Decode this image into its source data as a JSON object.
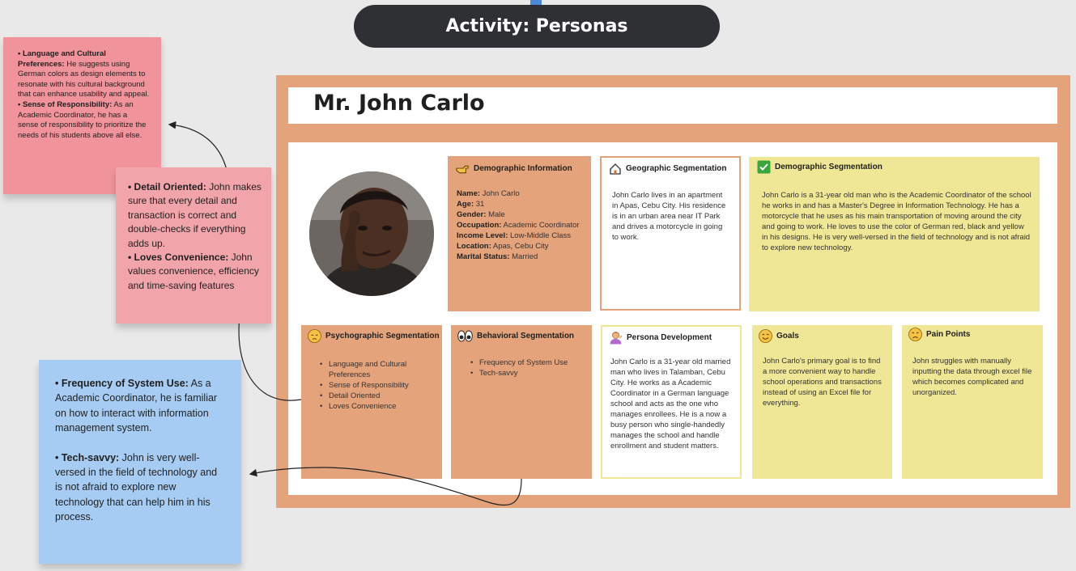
{
  "header": {
    "title": "Activity: Personas"
  },
  "persona": {
    "name": "Mr. John Carlo"
  },
  "cards": {
    "demographic_info": {
      "title": "Demographic Information",
      "rows": [
        {
          "label": "Name:",
          "value": " John Carlo"
        },
        {
          "label": "Age:",
          "value": " 31"
        },
        {
          "label": "Gender:",
          "value": " Male"
        },
        {
          "label": "Occupation:",
          "value": " Academic Coordinator"
        },
        {
          "label": "Income Level:",
          "value": " Low-Middle Class"
        },
        {
          "label": "Location:",
          "value": " Apas, Cebu City"
        },
        {
          "label": "Marital Status:",
          "value": " Married"
        }
      ]
    },
    "geographic": {
      "title": "Geographic Segmentation",
      "text": "John Carlo lives in an apartment in Apas, Cebu City. His residence is in an urban area near IT Park and drives a motorcycle in going to work."
    },
    "demographic_seg": {
      "title": "Demographic Segmentation",
      "text": "John Carlo is a 31-year old man who is the Academic Coordinator of the school he works in and has a Master's Degree in Information Technology. He has a motorcycle that he uses as his main transportation of moving around the city and going to work. He loves to use the color of German red, black and yellow in his designs. He is very well-versed in the field of technology and is not afraid to explore new technology."
    },
    "psychographic": {
      "title": "Psychographic Segmentation",
      "items": [
        "Language and Cultural Preferences",
        "Sense of Responsibility",
        "Detail Oriented",
        "Loves Convenience"
      ]
    },
    "behavioral": {
      "title": "Behavioral Segmentation",
      "items": [
        "Frequency of System Use",
        "Tech-savvy"
      ]
    },
    "persona_dev": {
      "title": "Persona Development",
      "text": "John Carlo is a 31-year old married man who lives in Talamban, Cebu City. He works as a Academic Coordinator in a German language school and acts as the one who manages enrollees. He is a now a busy person who single-handedly manages the school and handle enrollment and student matters."
    },
    "goals": {
      "title": "Goals",
      "text": "John Carlo's primary goal is to find a more convenient way to handle school operations and transactions instead of using an Excel file for everything."
    },
    "pain_points": {
      "title": "Pain Points",
      "text": "John struggles with manually inputting the data through excel file which becomes complicated and unorganized."
    }
  },
  "stickies": {
    "pink_top": {
      "b1": "• Language and Cultural Preferences:",
      "t1": " He suggests using German colors as design elements to resonate with his cultural background that can enhance usability and appeal.",
      "b2": "• Sense of Responsibility:",
      "t2": "  As an Academic Coordinator, he has a sense of responsibility to prioritize the needs of his students above all else."
    },
    "pink_mid": {
      "b1": "• Detail Oriented:",
      "t1": " John makes sure that every detail and transaction is correct and double-checks if everything adds up.",
      "b2": "• Loves Convenience:",
      "t2": " John values convenience, efficiency and time-saving features"
    },
    "blue": {
      "b1": "• Frequency of System Use:",
      "t1": " As a Academic Coordinator, he is familiar on how to interact with information management system.",
      "b2": "• Tech-savvy:",
      "t2": " John is very well-versed in the field of technology and is not afraid to explore new technology that can help him in his process."
    }
  },
  "colors": {
    "frame": "#e5a37c",
    "yellow": "#efe795",
    "pill": "#2f3033",
    "sticky_pink": "#f0939b",
    "sticky_blue": "#a7ccf3"
  },
  "icons": {
    "demographic_info": "pointing-hand-icon",
    "geographic": "house-icon",
    "demographic_seg": "check-box-icon",
    "psychographic": "pensive-face-icon",
    "behavioral": "eyes-icon",
    "persona_dev": "person-icon",
    "goals": "smiling-face-icon",
    "pain_points": "sad-face-icon"
  }
}
